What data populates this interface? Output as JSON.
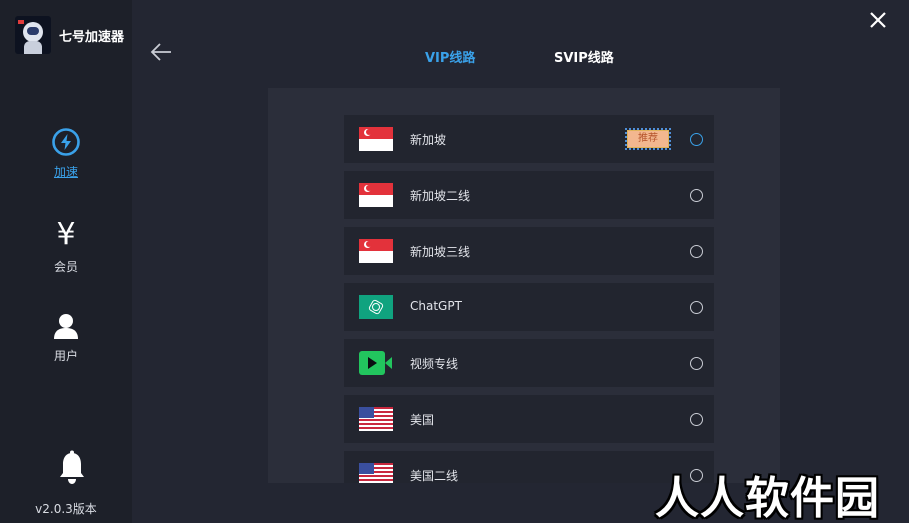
{
  "app": {
    "title": "七号加速器",
    "version": "v2.0.3版本"
  },
  "sidebar": {
    "items": [
      {
        "label": "加速",
        "icon": "lightning-icon",
        "active": true
      },
      {
        "label": "会员",
        "icon": "yen-icon",
        "glyph": "¥"
      },
      {
        "label": "用户",
        "icon": "user-icon"
      }
    ]
  },
  "header": {
    "tabs": [
      {
        "label": "VIP线路",
        "active": true
      },
      {
        "label": "SVIP线路",
        "active": false
      }
    ]
  },
  "routes": [
    {
      "name": "新加坡",
      "flag": "singapore-flag-icon",
      "badge": "推荐",
      "selected": true
    },
    {
      "name": "新加坡二线",
      "flag": "singapore-flag-icon",
      "selected": false
    },
    {
      "name": "新加坡三线",
      "flag": "singapore-flag-icon",
      "selected": false
    },
    {
      "name": "ChatGPT",
      "flag": "chatgpt-icon",
      "selected": false
    },
    {
      "name": "视频专线",
      "flag": "video-play-icon",
      "selected": false
    },
    {
      "name": "美国",
      "flag": "usa-flag-icon",
      "selected": false
    },
    {
      "name": "美国二线",
      "flag": "usa-flag-icon",
      "selected": false
    }
  ],
  "watermark": "人人软件园",
  "colors": {
    "accent": "#3aa1e9",
    "background": "#232632",
    "sidebar": "#1d2029",
    "panel": "#2b2e3a",
    "row": "#22252f"
  }
}
